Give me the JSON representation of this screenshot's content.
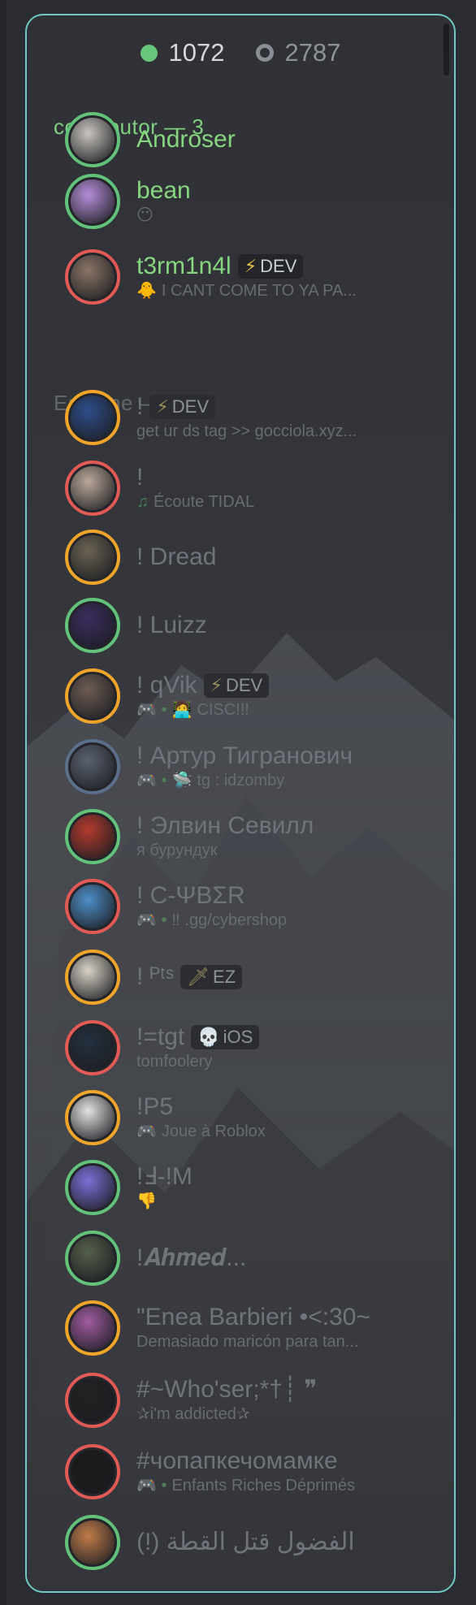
{
  "counts": {
    "online": "1072",
    "offline": "2787"
  },
  "sections": {
    "contributor": "contributor — 3",
    "online": "En ligne — 1069"
  },
  "members": [
    {
      "name": "Androser",
      "status": "",
      "tag": "",
      "ring": "green",
      "avatar_color": "#c9c5bf",
      "icon": "dog-stop-sign"
    },
    {
      "name": "bean",
      "status": "",
      "status_icon": "😶",
      "tag": "",
      "ring": "green",
      "avatar_color": "#b58ed8",
      "icon": "anime-avatar"
    },
    {
      "name": "t3rm1n4l",
      "status": "I CANT COME TO YA PA...",
      "status_icon": "🐥",
      "tag": "DEV",
      "tag_icon": "⚡",
      "ring": "red",
      "avatar_color": "#8a7566",
      "icon": "cat-sunglasses"
    },
    {
      "name": "!",
      "status": "get ur ds tag >> gocciola.xyz...",
      "tag": "DEV",
      "tag_icon": "⚡",
      "ring": "yellow",
      "avatar_color": "#2e4e8a",
      "icon": "cartoon-avatar"
    },
    {
      "name": "!",
      "status": "Écoute TIDAL",
      "status_icon": "♫",
      "tag": "",
      "ring": "red",
      "avatar_color": "#bba89a",
      "icon": "anime-face"
    },
    {
      "name": "! Dread",
      "status": "",
      "tag": "",
      "ring": "yellow",
      "avatar_color": "#6b6353",
      "icon": "sunglasses-face"
    },
    {
      "name": "! Luizz",
      "status": "",
      "tag": "",
      "ring": "green",
      "avatar_color": "#3b2c5e",
      "icon": "purple-orbs"
    },
    {
      "name": "! qVik",
      "status": "CISC!!!",
      "status_icon": "🧑‍💻",
      "game": "🎮 •",
      "tag": "DEV",
      "tag_icon": "⚡",
      "ring": "yellow",
      "avatar_color": "#6d5c53",
      "icon": "hamster"
    },
    {
      "name": "! Артур Тигранович",
      "status": "tg : idzomby",
      "status_icon": "🛸",
      "game": "🎮 •",
      "tag": "",
      "ring": "blue",
      "avatar_color": "#5a6270",
      "icon": "person"
    },
    {
      "name": "! Элвин Севилл",
      "status": "я бурундук",
      "tag": "",
      "ring": "green",
      "avatar_color": "#b33b2f",
      "icon": "chipmunk"
    },
    {
      "name": "! C-ΨBΣR",
      "status": ".gg/cybershop",
      "status_icon": "‼",
      "game": "🎮 •",
      "tag": "",
      "ring": "red",
      "avatar_color": "#4e8ec7",
      "icon": "pocoyo"
    },
    {
      "name": "! ᴾᵗˢ",
      "status": "",
      "tag": "EZ",
      "tag_icon": "🗡",
      "ring": "yellow",
      "avatar_color": "#d9d3c7",
      "icon": "doll"
    },
    {
      "name": "!=tgt",
      "status": "tomfoolery",
      "tag": "iOS",
      "tag_icon": "💀",
      "ring": "red",
      "avatar_color": "#24303f",
      "icon": "night-sky"
    },
    {
      "name": "!P5",
      "status": "Joue à Roblox",
      "game": "🎮",
      "tag": "",
      "ring": "yellow",
      "avatar_color": "#e2e2e2",
      "icon": "calligraphy"
    },
    {
      "name": "!Ⅎ-!M",
      "status": "",
      "status_icon": "👎",
      "tag": "",
      "ring": "green",
      "avatar_color": "#7b6fd6",
      "icon": "wifi-logo"
    },
    {
      "name": "!𝑨𝒉𝒎𝒆𝒅...",
      "status": "",
      "tag": "",
      "ring": "green",
      "avatar_color": "#55604c",
      "icon": "person-red"
    },
    {
      "name": "\"Enea Barbieri  •<:30~",
      "status": "Demasiado maricón para tan...",
      "tag": "",
      "ring": "yellow",
      "avatar_color": "#a05ca0",
      "icon": "pink-character"
    },
    {
      "name": "#~Who'ser;*†┊ ❞",
      "status": "✰i'm addicted✰",
      "tag": "",
      "ring": "red",
      "avatar_color": "#222",
      "icon": "bw-face"
    },
    {
      "name": "#чопапкечомамке",
      "status": "Enfants Riches Déprimés",
      "game": "🎮 •",
      "tag": "",
      "ring": "red",
      "avatar_color": "#1a1a1a",
      "icon": "dark-clock"
    },
    {
      "name": "(!) الفضول قتل القطة",
      "status": "",
      "tag": "",
      "ring": "green",
      "avatar_color": "#c07c4a",
      "icon": "cat"
    }
  ]
}
